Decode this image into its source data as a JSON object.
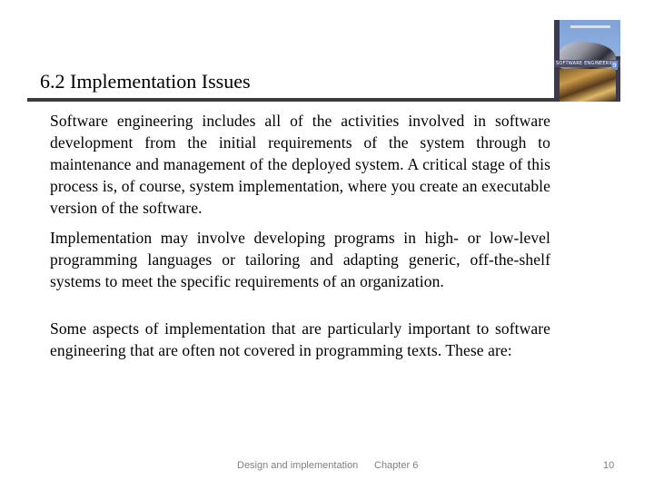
{
  "slide": {
    "title": "6.2 Implementation Issues",
    "cover_image": {
      "icon": "book-cover-image",
      "banner_text": "SOFTWARE ENGINEERING",
      "edition": "9"
    },
    "paragraphs": [
      "Software engineering includes all of the activities involved in software development from the initial requirements of the system through to maintenance and management of the deployed system. A critical stage of this process is, of course, system implementation, where you create an executable version of the software.",
      "Implementation may involve developing programs in high- or low-level programming languages or tailoring and adapting generic, off-the-shelf systems to meet the specific requirements of an organization.",
      "Some aspects of implementation that are particularly important to software engineering that are often not covered in programming texts. These are:"
    ],
    "footer": {
      "center": "Design and implementation",
      "chapter": "Chapter 6",
      "page_number": "10"
    }
  }
}
